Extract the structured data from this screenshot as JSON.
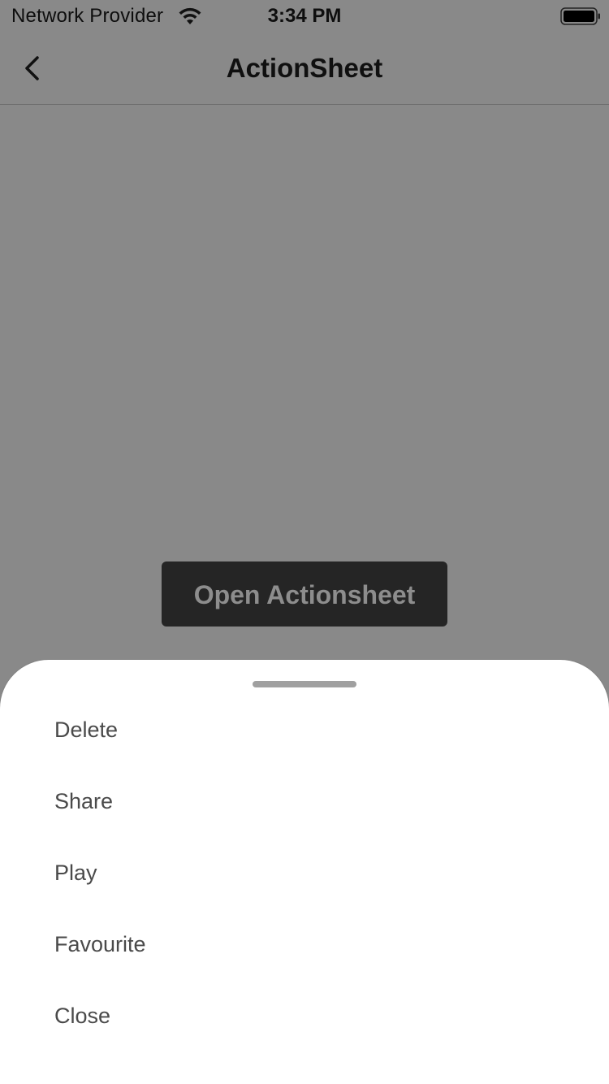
{
  "status_bar": {
    "carrier": "Network Provider",
    "time": "3:34 PM",
    "wifi_icon": "wifi-icon",
    "battery_icon": "battery-icon"
  },
  "nav": {
    "title": "ActionSheet",
    "back_icon": "chevron-left-icon"
  },
  "main": {
    "open_button_label": "Open Actionsheet"
  },
  "action_sheet": {
    "items": [
      {
        "label": "Delete"
      },
      {
        "label": "Share"
      },
      {
        "label": "Play"
      },
      {
        "label": "Favourite"
      },
      {
        "label": "Close"
      }
    ]
  },
  "colors": {
    "backdrop": "#898989",
    "button_bg": "#252525",
    "button_text": "#8d8d8d",
    "sheet_bg": "#ffffff",
    "item_text": "#4a4a4a"
  }
}
